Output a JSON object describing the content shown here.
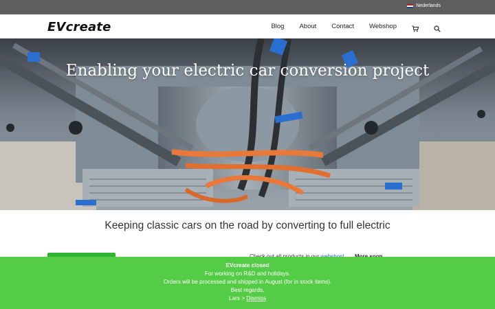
{
  "topbar": {
    "language": "Nederlands",
    "flag_colors": [
      "#ae1c28",
      "#ffffff",
      "#21468b"
    ]
  },
  "header": {
    "logo": "EVcreate",
    "menu": [
      {
        "label": "Blog"
      },
      {
        "label": "About"
      },
      {
        "label": "Contact"
      },
      {
        "label": "Webshop"
      }
    ],
    "cart_icon": "cart-icon",
    "search_icon": "search-icon"
  },
  "hero": {
    "title": "Enabling your electric car conversion project"
  },
  "main": {
    "subtitle": "Keeping classic cars on the road by converting to full electric",
    "shop_text": "Check out all products in our ",
    "shop_link": "webshop!",
    "more_soon": "More soon"
  },
  "notice": {
    "title": "EVcreate closed",
    "line1": "For working on R&D and holidays.",
    "line2": "Orders will be processed and shipped in August (for in stock items).",
    "line3": "Best regards,",
    "signoff": "Lars > ",
    "dismiss": "Dismiss"
  },
  "colors": {
    "topbar": "#5e5e5e",
    "notice": "#55cc45",
    "button": "#2fb52f"
  }
}
